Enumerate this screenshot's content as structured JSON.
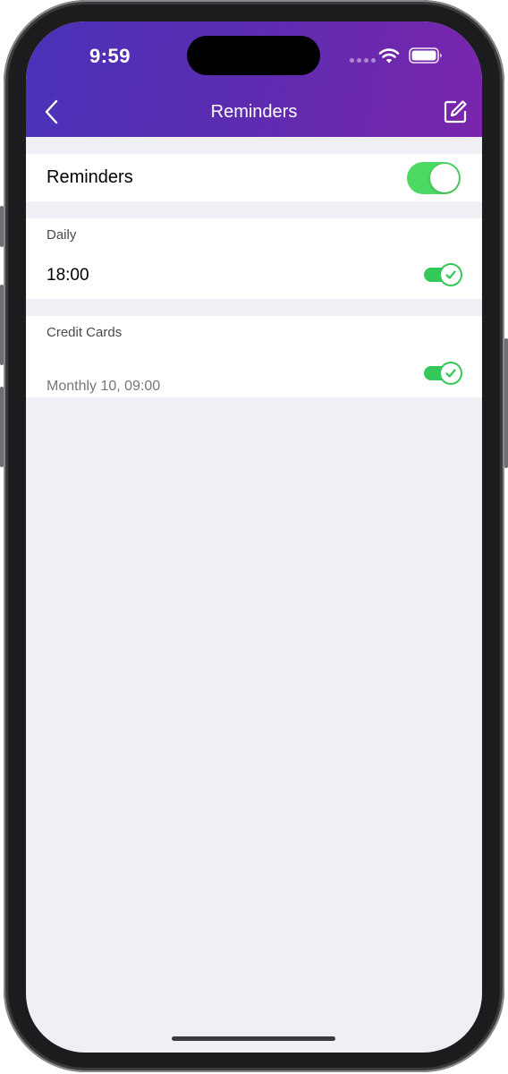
{
  "status_bar": {
    "time": "9:59"
  },
  "nav": {
    "title": "Reminders",
    "back_icon": "chevron-left-icon",
    "edit_icon": "compose-icon"
  },
  "master": {
    "label": "Reminders",
    "enabled": true
  },
  "daily": {
    "section_label": "Daily",
    "time": "18:00",
    "enabled": true
  },
  "credit_cards": {
    "section_label": "Credit Cards",
    "schedule": "Monthly 10, 09:00",
    "enabled": true
  },
  "colors": {
    "nav_gradient_start": "#4a32b8",
    "nav_gradient_end": "#7a25ad",
    "toggle_on": "#4cd964",
    "background": "#f0eff5"
  }
}
